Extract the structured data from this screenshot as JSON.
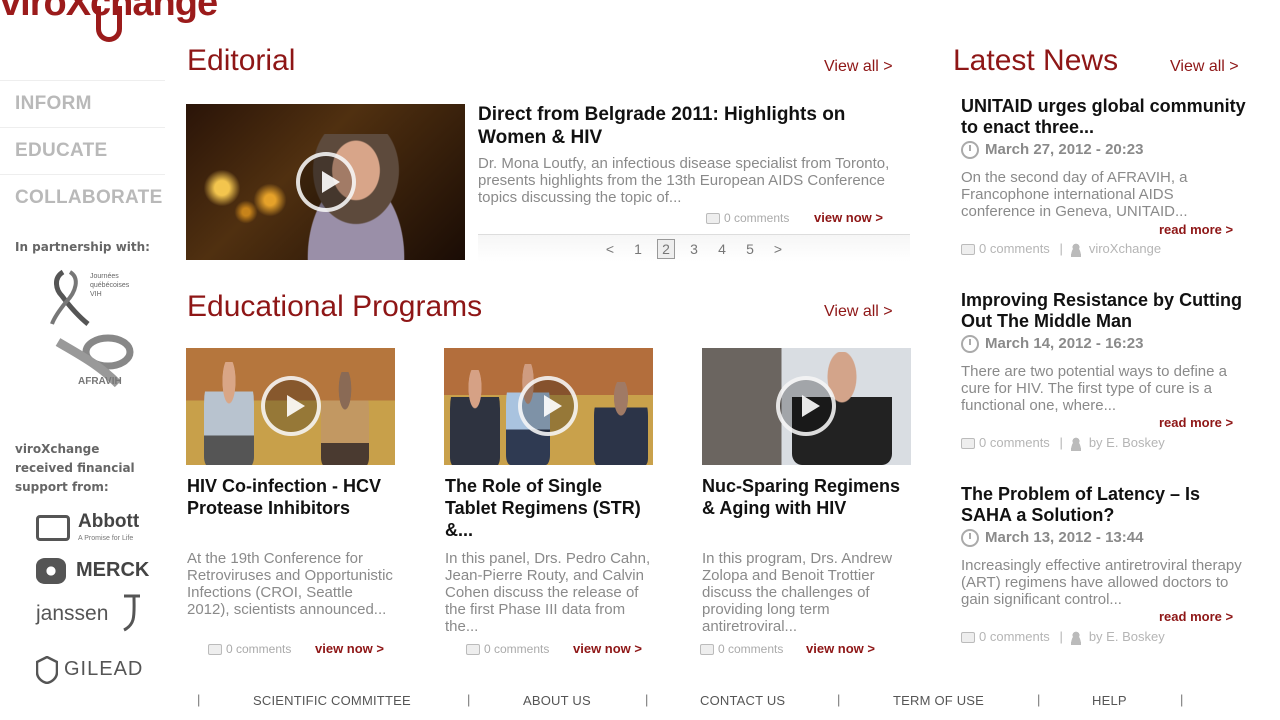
{
  "logo": {
    "text": "viroXchange"
  },
  "nav": {
    "items": [
      {
        "label": "INFORM"
      },
      {
        "label": "EDUCATE"
      },
      {
        "label": "COLLABORATE"
      }
    ]
  },
  "partners": {
    "label": "In partnership with:",
    "items": [
      {
        "name": "Journées québécoises VIH",
        "icon": "ribbon-logo"
      },
      {
        "name": "AFRAVIH",
        "icon": "ribbon-logo"
      }
    ]
  },
  "sponsors": {
    "label": "viroXchange received financial support from:",
    "items": [
      {
        "name": "Abbott",
        "tagline": "A Promise for Life"
      },
      {
        "name": "MERCK"
      },
      {
        "name": "janssen"
      },
      {
        "name": "GILEAD"
      }
    ]
  },
  "editorial": {
    "heading": "Editorial",
    "view_all": "View all >",
    "title": "Direct from Belgrade 2011: Highlights on Women & HIV",
    "body": "Dr. Mona Loutfy, an infectious disease specialist from Toronto, presents highlights from the 13th European AIDS Conference topics discussing the topic of...",
    "comments": "0 comments",
    "view_now": "view now >",
    "pager": [
      "<",
      "1",
      "2",
      "3",
      "4",
      "5",
      ">"
    ],
    "active_page": "2"
  },
  "programs": {
    "heading": "Educational Programs",
    "view_all": "View all >",
    "items": [
      {
        "title": "HIV Co-infection - HCV Protease Inhibitors",
        "body": "At the 19th Conference for Retroviruses and Opportunistic Infections (CROI, Seattle 2012), scientists announced...",
        "comments": "0 comments",
        "view_now": "view now >"
      },
      {
        "title": "The Role of Single Tablet Regimens (STR) &...",
        "body": "In this panel, Drs. Pedro Cahn, Jean-Pierre Routy, and Calvin Cohen discuss the release of the first Phase III data from the...",
        "comments": "0 comments",
        "view_now": "view now >"
      },
      {
        "title": "Nuc-Sparing Regimens & Aging with HIV",
        "body": "In this program, Drs. Andrew Zolopa and Benoit Trottier discuss the challenges of providing long term antiretroviral...",
        "comments": "0 comments",
        "view_now": "view now >"
      }
    ]
  },
  "news": {
    "heading": "Latest News",
    "view_all": "View all >",
    "items": [
      {
        "title": "UNITAID urges global community to enact three...",
        "date": "March 27, 2012 - 20:23",
        "body": "On the second day of AFRAVIH, a Francophone international AIDS conference in Geneva, UNITAID...",
        "read_more": "read more >",
        "comments": "0 comments",
        "author": "viroXchange"
      },
      {
        "title": "Improving Resistance by Cutting Out The Middle Man",
        "date": "March 14, 2012 - 16:23",
        "body": "There are two potential ways to define a cure for HIV. The first type of cure is a functional one, where...",
        "read_more": "read more >",
        "comments": "0 comments",
        "author": "by E. Boskey"
      },
      {
        "title": "The Problem of Latency – Is SAHA a Solution?",
        "date": "March 13, 2012 - 13:44",
        "body": "Increasingly effective antiretroviral therapy (ART) regimens have allowed doctors to gain significant control...",
        "read_more": "read more >",
        "comments": "0 comments",
        "author": "by E. Boskey"
      }
    ]
  },
  "footer": {
    "links": [
      {
        "label": "SCIENTIFIC COMMITTEE"
      },
      {
        "label": "ABOUT US"
      },
      {
        "label": "CONTACT US"
      },
      {
        "label": "TERM OF USE"
      },
      {
        "label": "HELP"
      }
    ],
    "separator": "|"
  },
  "colors": {
    "brand": "#8e1616",
    "muted_text": "#8a8a8a",
    "nav_text": "#b9b9b9"
  }
}
